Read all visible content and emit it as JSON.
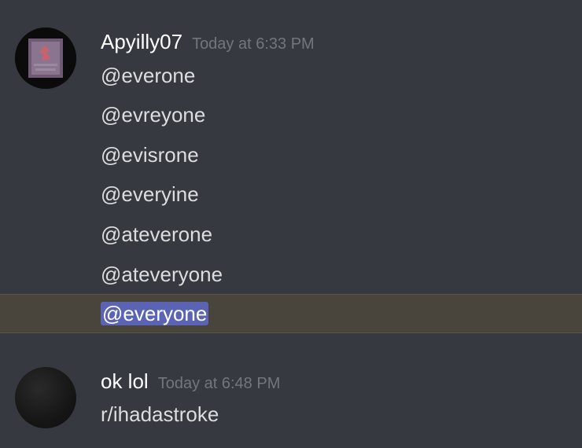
{
  "messages": [
    {
      "username": "Apyilly07",
      "timestamp": "Today at 6:33 PM",
      "lines": [
        "@everone",
        "@evreyone",
        "@evisrone",
        "@everyine",
        "@ateverone",
        "@ateveryone"
      ],
      "mention": "@everyone"
    },
    {
      "username": "ok lol",
      "timestamp": "Today at 6:48 PM",
      "lines": [
        "r/ihadastroke"
      ]
    }
  ],
  "colors": {
    "background": "#36393f",
    "mention_highlight_row": "#49443c",
    "mention_pill": "#5a63b4",
    "username": "#ffffff",
    "timestamp": "#72767d",
    "message_text": "#dcddde"
  }
}
